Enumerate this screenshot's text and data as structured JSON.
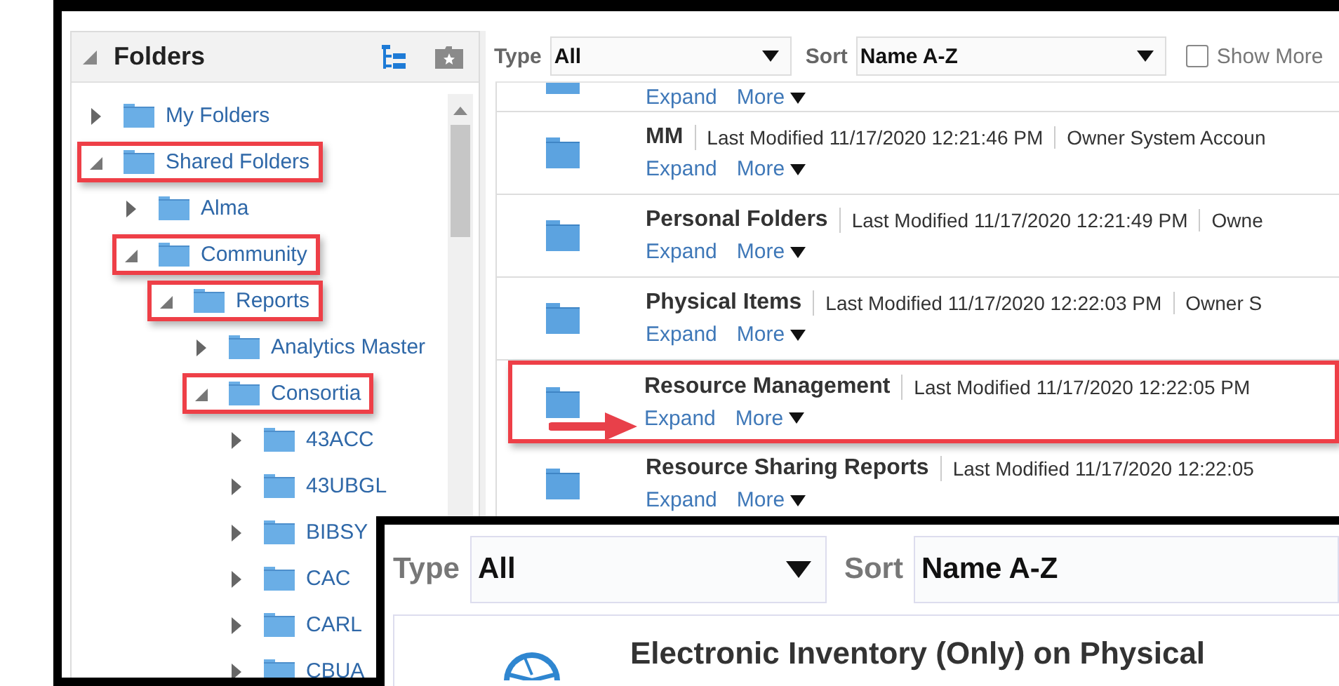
{
  "folders_panel": {
    "title": "Folders",
    "tree": [
      {
        "label": "My Folders",
        "expanded": false,
        "highlighted": false
      },
      {
        "label": "Shared Folders",
        "expanded": true,
        "highlighted": true,
        "children": [
          {
            "label": "Alma",
            "expanded": false,
            "highlighted": false
          },
          {
            "label": "Community",
            "expanded": true,
            "highlighted": true,
            "children": [
              {
                "label": "Reports",
                "expanded": true,
                "highlighted": true,
                "children": [
                  {
                    "label": "Analytics Master",
                    "expanded": false,
                    "highlighted": false
                  },
                  {
                    "label": "Consortia",
                    "expanded": true,
                    "highlighted": true,
                    "children": [
                      {
                        "label": "43ACC",
                        "expanded": false,
                        "highlighted": false
                      },
                      {
                        "label": "43UBGL",
                        "expanded": false,
                        "highlighted": false
                      },
                      {
                        "label": "BIBSY",
                        "expanded": false,
                        "highlighted": false
                      },
                      {
                        "label": "CAC",
                        "expanded": false,
                        "highlighted": false
                      },
                      {
                        "label": "CARL",
                        "expanded": false,
                        "highlighted": false
                      },
                      {
                        "label": "CBUA",
                        "expanded": false,
                        "highlighted": false
                      }
                    ]
                  }
                ]
              }
            ]
          }
        ]
      }
    ]
  },
  "toolbar": {
    "type_label": "Type",
    "type_value": "All",
    "sort_label": "Sort",
    "sort_value": "Name A-Z",
    "show_more": {
      "label": "Show More",
      "checked": false
    }
  },
  "results": [
    {
      "expand": "Expand",
      "more": "More",
      "highlighted": false
    },
    {
      "name": "MM",
      "modified": "Last Modified 11/17/2020 12:21:46 PM",
      "owner": "Owner System Accoun",
      "expand": "Expand",
      "more": "More",
      "highlighted": false
    },
    {
      "name": "Personal Folders",
      "modified": "Last Modified 11/17/2020 12:21:49 PM",
      "owner": "Owne",
      "expand": "Expand",
      "more": "More",
      "highlighted": false
    },
    {
      "name": "Physical Items",
      "modified": "Last Modified 11/17/2020 12:22:03 PM",
      "owner": "Owner S",
      "expand": "Expand",
      "more": "More",
      "highlighted": false
    },
    {
      "name": "Resource Management",
      "modified": "Last Modified 11/17/2020 12:22:05 PM",
      "expand": "Expand",
      "more": "More",
      "highlighted": true
    },
    {
      "name": "Resource Sharing Reports",
      "modified": "Last Modified 11/17/2020 12:22:05",
      "expand": "Expand",
      "more": "More",
      "highlighted": false
    }
  ],
  "inset": {
    "type_label": "Type",
    "type_value": "All",
    "sort_label": "Sort",
    "sort_value": "Name A-Z",
    "item_title": "Electronic Inventory (Only) on Physical"
  }
}
